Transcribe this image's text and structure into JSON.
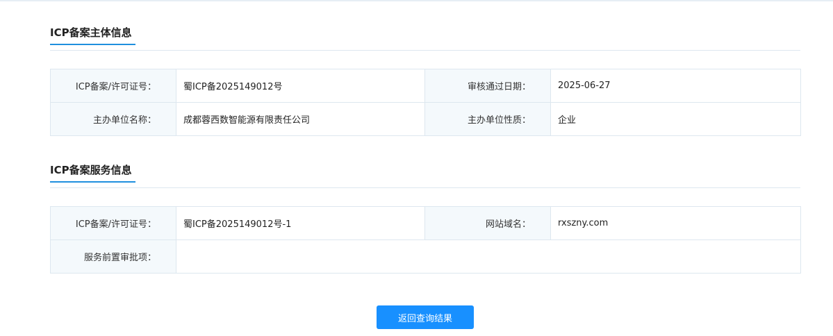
{
  "subject_section": {
    "title": "ICP备案主体信息",
    "rows": [
      {
        "label1": "ICP备案/许可证号：",
        "value1": "蜀ICP备2025149012号",
        "label2": "审核通过日期：",
        "value2": "2025-06-27"
      },
      {
        "label1": "主办单位名称：",
        "value1": "成都蓉西数智能源有限责任公司",
        "label2": "主办单位性质：",
        "value2": "企业"
      }
    ]
  },
  "service_section": {
    "title": "ICP备案服务信息",
    "license_label": "ICP备案/许可证号：",
    "license_value": "蜀ICP备2025149012号-1",
    "domain_label": "网站域名：",
    "domain_value": "rxszny.com",
    "approval_label": "服务前置审批项：",
    "approval_value": ""
  },
  "back_button": {
    "label": "返回查询结果"
  },
  "colors": {
    "accent": "#1890ff",
    "underline": "#1f8fde",
    "label_bg": "#f4f9fc",
    "border": "#dde7ef"
  }
}
